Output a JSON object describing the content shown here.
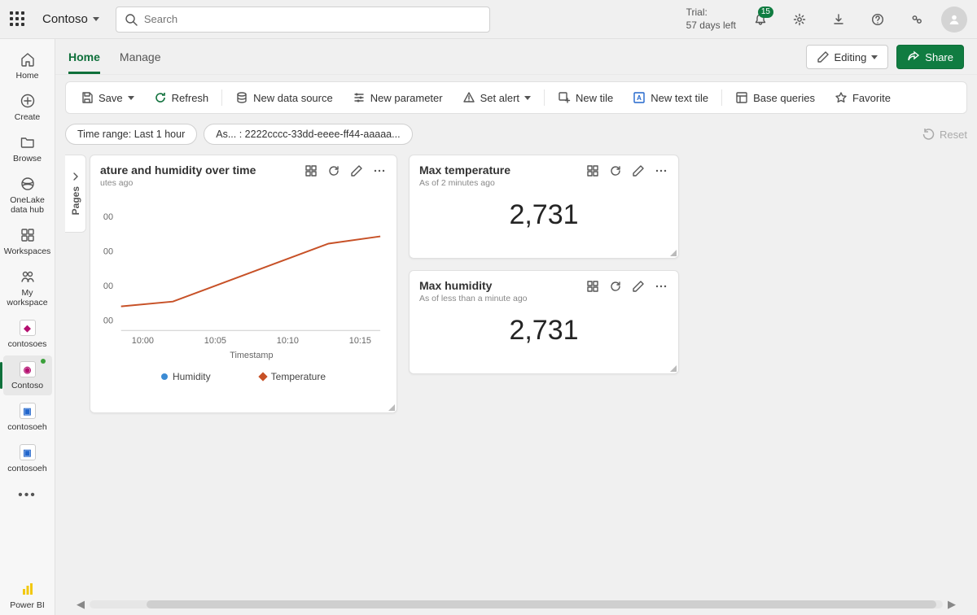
{
  "header": {
    "workspace_name": "Contoso",
    "search_placeholder": "Search",
    "trial_line1": "Trial:",
    "trial_line2": "57 days left",
    "notification_count": "15"
  },
  "leftnav": {
    "items": [
      {
        "label": "Home",
        "icon": "home"
      },
      {
        "label": "Create",
        "icon": "plus-circle"
      },
      {
        "label": "Browse",
        "icon": "folder"
      },
      {
        "label": "OneLake data hub",
        "icon": "onelake"
      },
      {
        "label": "Workspaces",
        "icon": "workspaces"
      },
      {
        "label": "My workspace",
        "icon": "my-ws"
      },
      {
        "label": "contosoes",
        "icon": "tile",
        "tile_color": "#b40e6f"
      },
      {
        "label": "Contoso",
        "icon": "tile",
        "tile_color": "#b40e6f",
        "active": true,
        "dot": true
      },
      {
        "label": "contosoeh",
        "icon": "tile",
        "tile_color": "#2266cc"
      },
      {
        "label": "contosoeh",
        "icon": "tile",
        "tile_color": "#2266cc"
      }
    ],
    "bottom_label": "Power BI"
  },
  "tabs": {
    "home": "Home",
    "manage": "Manage",
    "editing": "Editing",
    "share": "Share"
  },
  "toolbar": {
    "save": "Save",
    "refresh": "Refresh",
    "new_data_source": "New data source",
    "new_parameter": "New parameter",
    "set_alert": "Set alert",
    "new_tile": "New tile",
    "new_text_tile": "New text tile",
    "base_queries": "Base queries",
    "favorite": "Favorite"
  },
  "pills": {
    "time_range": "Time range: Last 1 hour",
    "asset": "As... : 2222cccc-33dd-eeee-ff44-aaaaa...",
    "reset": "Reset"
  },
  "pages_label": "Pages",
  "cards": {
    "chart": {
      "title": "ature and humidity over time",
      "subtitle": "utes ago",
      "xlabel": "Timestamp"
    },
    "max_temp": {
      "title": "Max temperature",
      "subtitle": "As of 2 minutes ago",
      "value": "2,731"
    },
    "max_hum": {
      "title": "Max humidity",
      "subtitle": "As of less than a minute ago",
      "value": "2,731"
    }
  },
  "chart_data": {
    "type": "line",
    "title": "Temperature and humidity over time",
    "xlabel": "Timestamp",
    "ylabel": "",
    "x_ticks": [
      "10:00",
      "10:05",
      "10:10",
      "10:15"
    ],
    "y_ticks": [
      "00",
      "00",
      "00",
      "00"
    ],
    "series": [
      {
        "name": "Humidity",
        "color": "#3b8bd4",
        "visible_points": []
      },
      {
        "name": "Temperature",
        "color": "#c75127",
        "x": [
          "09:58",
          "10:00",
          "10:05",
          "10:10",
          "10:15",
          "10:17"
        ],
        "y_rel": [
          0.2,
          0.24,
          0.4,
          0.56,
          0.72,
          0.78
        ]
      }
    ],
    "legend": [
      "Humidity",
      "Temperature"
    ]
  }
}
